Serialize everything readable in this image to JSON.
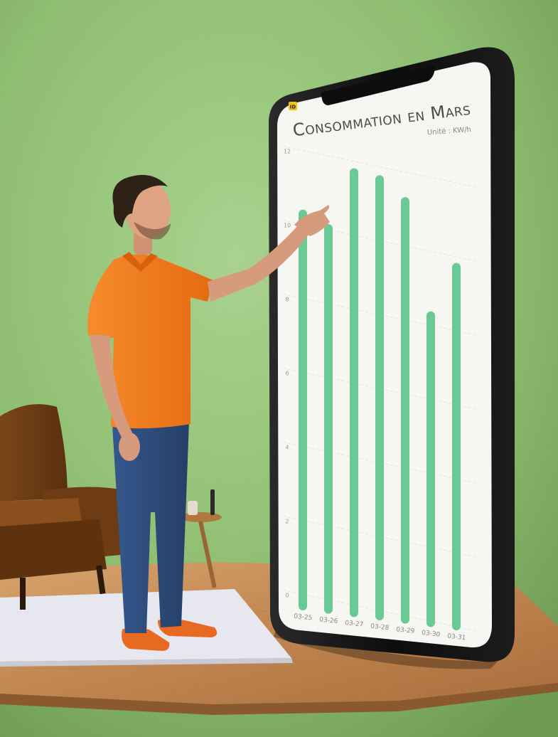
{
  "app": {
    "title": "Consommation en Mars",
    "unit_label": "Unité : KW/h",
    "logo_text": "ID"
  },
  "colors": {
    "background": "#8fbf72",
    "bar": "#6cc994",
    "phone_frame": "#0d0d0d",
    "screen": "#f7f7f5",
    "title": "#444444",
    "shirt": "#f47a1f",
    "jeans": "#2d4b7a",
    "chair": "#6a3a14",
    "floor_wood": "#c8905a",
    "rug": "#e8e8ee"
  },
  "chart_data": {
    "type": "bar",
    "title": "Consommation en Mars",
    "unit": "Unité : KW/h",
    "categories": [
      "03-25",
      "03-26",
      "03-27",
      "03-28",
      "03-29",
      "03-30",
      "03-31"
    ],
    "values": [
      10.6,
      10.3,
      11.9,
      11.8,
      11.3,
      8.3,
      9.7
    ],
    "ylim": [
      0,
      12
    ],
    "yticks": [
      "0",
      "2",
      "4",
      "6",
      "8",
      "10",
      "12"
    ],
    "grid": true,
    "legend": "none"
  }
}
